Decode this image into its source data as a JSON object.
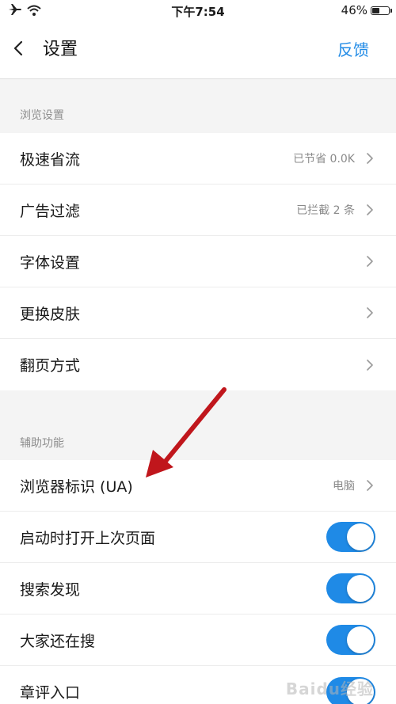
{
  "status_bar": {
    "time": "下午7:54",
    "battery": "46%",
    "battery_level": 0.46
  },
  "nav": {
    "title": "设置",
    "feedback": "反馈"
  },
  "sections": [
    {
      "header": "浏览设置",
      "rows": [
        {
          "label": "极速省流",
          "value": "已节省 0.0K",
          "control": "chevron"
        },
        {
          "label": "广告过滤",
          "value": "已拦截 2 条",
          "control": "chevron"
        },
        {
          "label": "字体设置",
          "value": "",
          "control": "chevron"
        },
        {
          "label": "更换皮肤",
          "value": "",
          "control": "chevron"
        },
        {
          "label": "翻页方式",
          "value": "",
          "control": "chevron"
        }
      ]
    },
    {
      "header": "辅助功能",
      "rows": [
        {
          "label": "浏览器标识 (UA)",
          "value": "电脑",
          "control": "chevron"
        },
        {
          "label": "启动时打开上次页面",
          "value": "",
          "control": "toggle",
          "on": true
        },
        {
          "label": "搜索发现",
          "value": "",
          "control": "toggle",
          "on": true
        },
        {
          "label": "大家还在搜",
          "value": "",
          "control": "toggle",
          "on": true
        },
        {
          "label": "章评入口",
          "value": "",
          "control": "toggle",
          "on": true
        }
      ]
    }
  ],
  "watermark": "Baidu经验",
  "colors": {
    "accent": "#1f8ae6",
    "annotation_arrow": "#c0161c"
  }
}
